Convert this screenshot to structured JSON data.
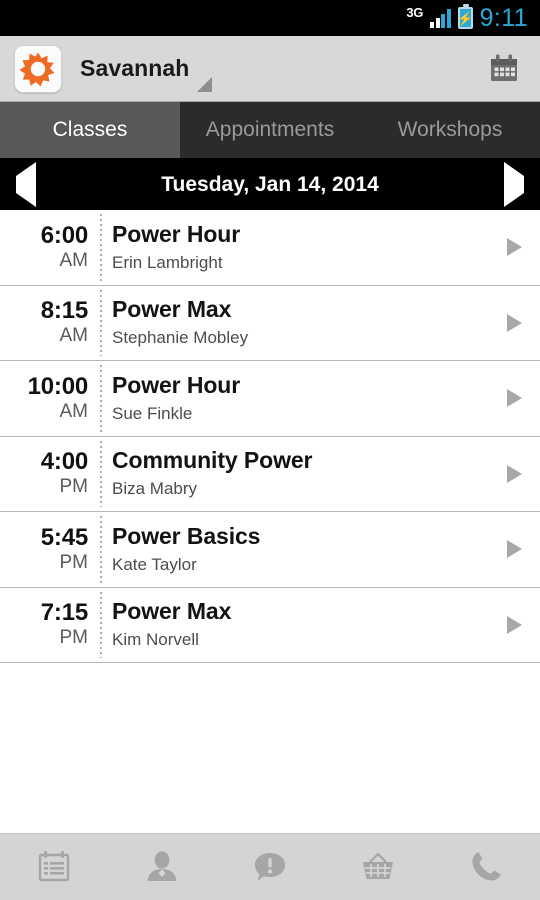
{
  "statusbar": {
    "network_label": "3G",
    "battery_state": "charging",
    "time": "9:11",
    "accent_color": "#2aa8d8"
  },
  "header": {
    "app_icon": "orange-starburst-icon",
    "brand_name": "Savannah",
    "dropdown_icon": "caret-down-icon",
    "calendar_button_icon": "calendar-icon",
    "brand_accent_color": "#ef6a23"
  },
  "tabs": {
    "items": [
      {
        "label": "Classes",
        "active": true
      },
      {
        "label": "Appointments",
        "active": false
      },
      {
        "label": "Workshops",
        "active": false
      }
    ]
  },
  "datebar": {
    "prev_icon": "left-triangle-icon",
    "next_icon": "right-triangle-icon",
    "date": "Tuesday, Jan 14, 2014"
  },
  "schedule": {
    "rows": [
      {
        "time": "6:00",
        "meridiem": "AM",
        "name": "Power Hour",
        "instructor": "Erin Lambright"
      },
      {
        "time": "8:15",
        "meridiem": "AM",
        "name": "Power Max",
        "instructor": "Stephanie Mobley"
      },
      {
        "time": "10:00",
        "meridiem": "AM",
        "name": "Power Hour",
        "instructor": "Sue Finkle"
      },
      {
        "time": "4:00",
        "meridiem": "PM",
        "name": "Community Power",
        "instructor": "Biza Mabry"
      },
      {
        "time": "5:45",
        "meridiem": "PM",
        "name": "Power Basics",
        "instructor": "Kate Taylor"
      },
      {
        "time": "7:15",
        "meridiem": "PM",
        "name": "Power Max",
        "instructor": "Kim Norvell"
      }
    ]
  },
  "bottomnav": {
    "items": [
      {
        "icon": "schedule-icon"
      },
      {
        "icon": "profile-icon"
      },
      {
        "icon": "alert-bubble-icon"
      },
      {
        "icon": "shopping-basket-icon"
      },
      {
        "icon": "phone-icon"
      }
    ]
  }
}
